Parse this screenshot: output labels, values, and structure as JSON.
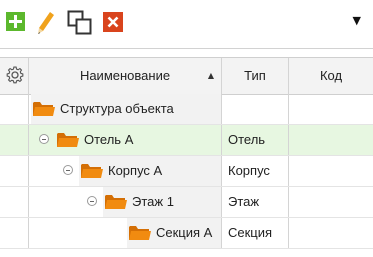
{
  "toolbar": {
    "buttons": [
      {
        "id": "add",
        "icon": "plus-icon",
        "color": "#5cb82d"
      },
      {
        "id": "edit",
        "icon": "pencil-icon",
        "color": "#f0a21c"
      },
      {
        "id": "copy",
        "icon": "copy-icon",
        "color": "#333333"
      },
      {
        "id": "delete",
        "icon": "close-icon",
        "color": "#d9441d"
      }
    ],
    "dropdown_glyph": "▼"
  },
  "grid": {
    "settings_icon": "gear-icon",
    "columns": [
      {
        "label": "Наименование",
        "sort": "ascending"
      },
      {
        "label": "Тип"
      },
      {
        "label": "Код"
      }
    ],
    "sort_glyph": "▲",
    "rows": [
      {
        "name": "Структура объекта",
        "type": "",
        "code": "",
        "level": 0,
        "expanded": null,
        "selected": false
      },
      {
        "name": "Отель А",
        "type": "Отель",
        "code": "",
        "level": 1,
        "expanded": true,
        "selected": true
      },
      {
        "name": "Корпус А",
        "type": "Корпус",
        "code": "",
        "level": 2,
        "expanded": true,
        "selected": false
      },
      {
        "name": "Этаж 1",
        "type": "Этаж",
        "code": "",
        "level": 3,
        "expanded": true,
        "selected": false
      },
      {
        "name": "Секция А",
        "type": "Секция",
        "code": "",
        "level": 4,
        "expanded": null,
        "selected": false
      }
    ]
  },
  "colors": {
    "folder": "#f18b10",
    "selected_row": "#e7f7e1",
    "header_bg": "#f3f3f3"
  }
}
